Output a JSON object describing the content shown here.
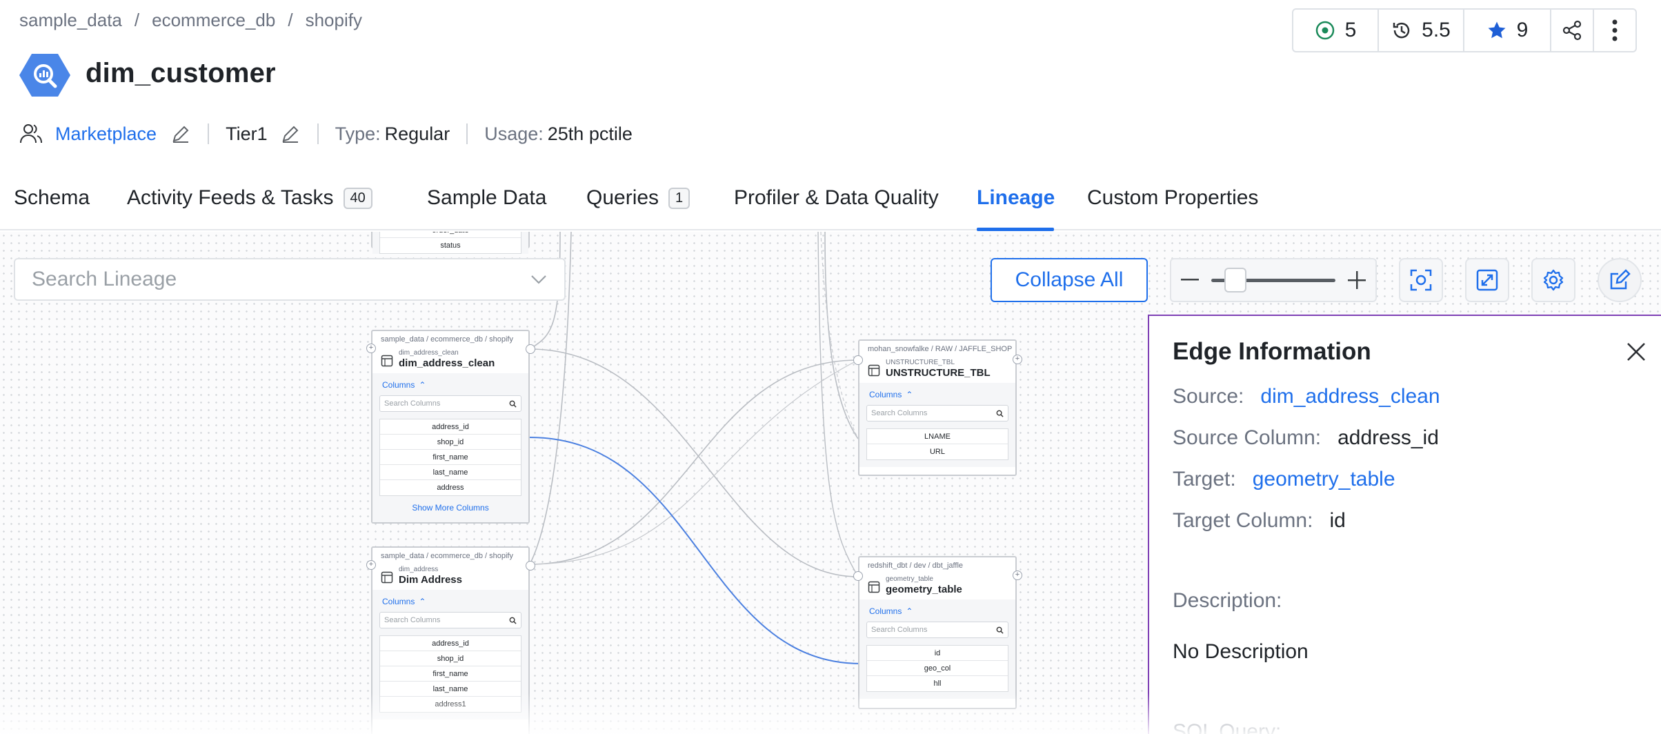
{
  "breadcrumb": [
    "sample_data",
    "ecommerce_db",
    "shopify"
  ],
  "title": "dim_customer",
  "stats": {
    "followers": "5",
    "version": "5.5",
    "stars": "9"
  },
  "meta": {
    "owner": "Marketplace",
    "tier": "Tier1",
    "type_label": "Type:",
    "type_value": "Regular",
    "usage_label": "Usage:",
    "usage_value": "25th pctile"
  },
  "tabs": [
    {
      "label": "Schema"
    },
    {
      "label": "Activity Feeds & Tasks",
      "count": "40"
    },
    {
      "label": "Sample Data"
    },
    {
      "label": "Queries",
      "count": "1"
    },
    {
      "label": "Profiler & Data Quality"
    },
    {
      "label": "Lineage"
    },
    {
      "label": "Custom Properties"
    }
  ],
  "active_tab": "Lineage",
  "lineage": {
    "search_placeholder": "Search Lineage",
    "collapse_all": "Collapse All",
    "zoom_level": 0.15,
    "partial_node": {
      "columns": [
        "order_date",
        "status"
      ]
    },
    "nodes": [
      {
        "path": "sample_data / ecommerce_db / shopify",
        "sub": "dim_address_clean",
        "name": "dim_address_clean",
        "columns_label": "Columns",
        "search_placeholder": "Search Columns",
        "columns": [
          "address_id",
          "shop_id",
          "first_name",
          "last_name",
          "address"
        ],
        "more": "Show More Columns"
      },
      {
        "path": "sample_data / ecommerce_db / shopify",
        "sub": "dim_address",
        "name": "Dim Address",
        "columns_label": "Columns",
        "search_placeholder": "Search Columns",
        "columns": [
          "address_id",
          "shop_id",
          "first_name",
          "last_name",
          "address1"
        ]
      },
      {
        "path": "mohan_snowfalke / RAW / JAFFLE_SHOP",
        "sub": "UNSTRUCTURE_TBL",
        "name": "UNSTRUCTURE_TBL",
        "columns_label": "Columns",
        "search_placeholder": "Search Columns",
        "columns": [
          "LNAME",
          "URL"
        ]
      },
      {
        "path": "redshift_dbt / dev / dbt_jaffle",
        "sub": "geometry_table",
        "name": "geometry_table",
        "columns_label": "Columns",
        "search_placeholder": "Search Columns",
        "columns": [
          "id",
          "geo_col",
          "hll"
        ]
      }
    ]
  },
  "edge_info": {
    "title": "Edge Information",
    "source_label": "Source:",
    "source_value": "dim_address_clean",
    "source_column_label": "Source Column:",
    "source_column_value": "address_id",
    "target_label": "Target:",
    "target_value": "geometry_table",
    "target_column_label": "Target Column:",
    "target_column_value": "id",
    "description_label": "Description:",
    "description_value": "No Description",
    "sql_label": "SQL Query:"
  },
  "colors": {
    "accent": "#1f6feb",
    "panel_border": "#7e3fb5",
    "edge": "#b9bdc3",
    "edge_selected": "#4a7fe0"
  }
}
